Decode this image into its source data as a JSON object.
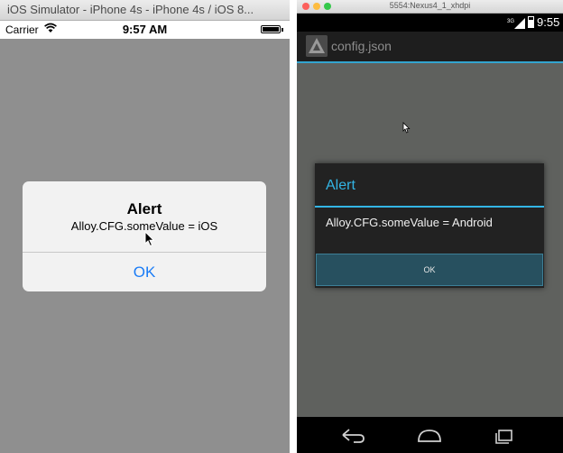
{
  "ios": {
    "window_title": "iOS Simulator - iPhone 4s - iPhone 4s / iOS 8...",
    "status": {
      "carrier": "Carrier",
      "time": "9:57 AM"
    },
    "alert": {
      "title": "Alert",
      "message": "Alloy.CFG.someValue = iOS",
      "ok_label": "OK"
    },
    "colors": {
      "button_text": "#1a7cf6",
      "screen_background": "#8f8f8f"
    }
  },
  "android": {
    "window_title": "5554:Nexus4_1_xhdpi",
    "status": {
      "time": "9:55",
      "network": "3G"
    },
    "action_bar": {
      "title": "config.json"
    },
    "alert": {
      "title": "Alert",
      "message": "Alloy.CFG.someValue = Android",
      "ok_label": "OK"
    },
    "nav_buttons": [
      "back-icon",
      "home-icon",
      "recents-icon"
    ],
    "colors": {
      "accent": "#33b5e5",
      "dialog_background": "#222222",
      "ok_button": "#27505f"
    }
  }
}
